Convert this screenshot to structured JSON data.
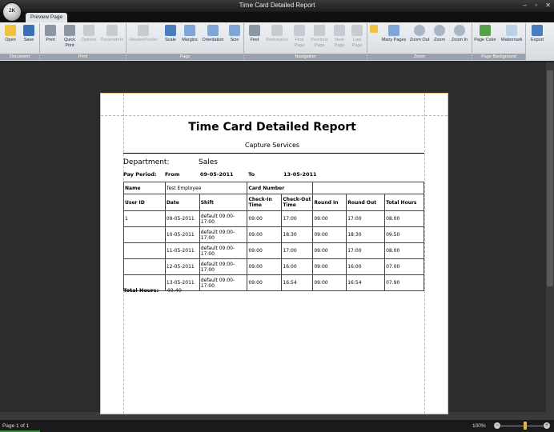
{
  "window": {
    "title": "Time Card Detailed Report",
    "controls": [
      "–",
      "▫",
      "✕"
    ],
    "app_logo": "ZK"
  },
  "tabs": [
    {
      "label": "Preview Page"
    }
  ],
  "ribbon": {
    "groups": [
      {
        "label": "Document",
        "buttons": [
          "Open",
          "Save"
        ]
      },
      {
        "label": "Print",
        "buttons": [
          "Print",
          "Quick Print",
          "Options",
          "Parameters"
        ]
      },
      {
        "label": "Page",
        "buttons": [
          "Header/Footer",
          "Scale",
          "Margins",
          "Orientation",
          "Size"
        ]
      },
      {
        "label": "Navigation",
        "buttons": [
          "Find",
          "Bookmarks",
          "First Page",
          "Previous Page",
          "Next Page",
          "Last Page"
        ]
      },
      {
        "label": "Zoom",
        "buttons": [
          "Many Pages",
          "Zoom Out",
          "Zoom",
          "Zoom In"
        ]
      },
      {
        "label": "Page Background",
        "buttons": [
          "Page Color",
          "Watermark"
        ]
      },
      {
        "label": "Export",
        "buttons": [
          "Export"
        ]
      }
    ]
  },
  "report": {
    "title": "Time Card Detailed Report",
    "subtitle": "Capture Services",
    "department_label": "Department:",
    "department_value": "Sales",
    "pay_period_label": "Pay Period:",
    "from_label": "From",
    "from_value": "09-05-2011",
    "to_label": "To",
    "to_value": "13-05-2011",
    "name_label": "Name",
    "name_value": "Test Employee",
    "card_number_label": "Card Number",
    "card_number_value": "",
    "columns": [
      "User ID",
      "Date",
      "Shift",
      "Check-In Time",
      "Check-Out Time",
      "Round In",
      "Round Out",
      "Total Hours"
    ],
    "rows": [
      [
        "1",
        "09-05-2011",
        "default 09:00-17:00",
        "09:00",
        "17:00",
        "09:00",
        "17:00",
        "08.00"
      ],
      [
        "",
        "10-05-2011",
        "default 09:00-17:00",
        "09:00",
        "18:30",
        "09:00",
        "18:30",
        "09.50"
      ],
      [
        "",
        "11-05-2011",
        "default 09:00-17:00",
        "09:00",
        "17:00",
        "09:00",
        "17:00",
        "08.00"
      ],
      [
        "",
        "12-05-2011",
        "default 09:00-17:00",
        "09:00",
        "16:00",
        "09:00",
        "16:00",
        "07.00"
      ],
      [
        "",
        "13-05-2011",
        "default 09:00-17:00",
        "09:00",
        "16:54",
        "09:00",
        "16:54",
        "07.90"
      ]
    ],
    "total_label": "Total Hours:",
    "total_value": "40.40"
  },
  "status": {
    "page": "Page 1 of 1",
    "zoom": "100%",
    "zoom_level_percent": 100
  },
  "colors": {
    "accent": "#e5b73b",
    "ribbon": "#dfe3e8",
    "workspace": "#2c2c2c"
  }
}
